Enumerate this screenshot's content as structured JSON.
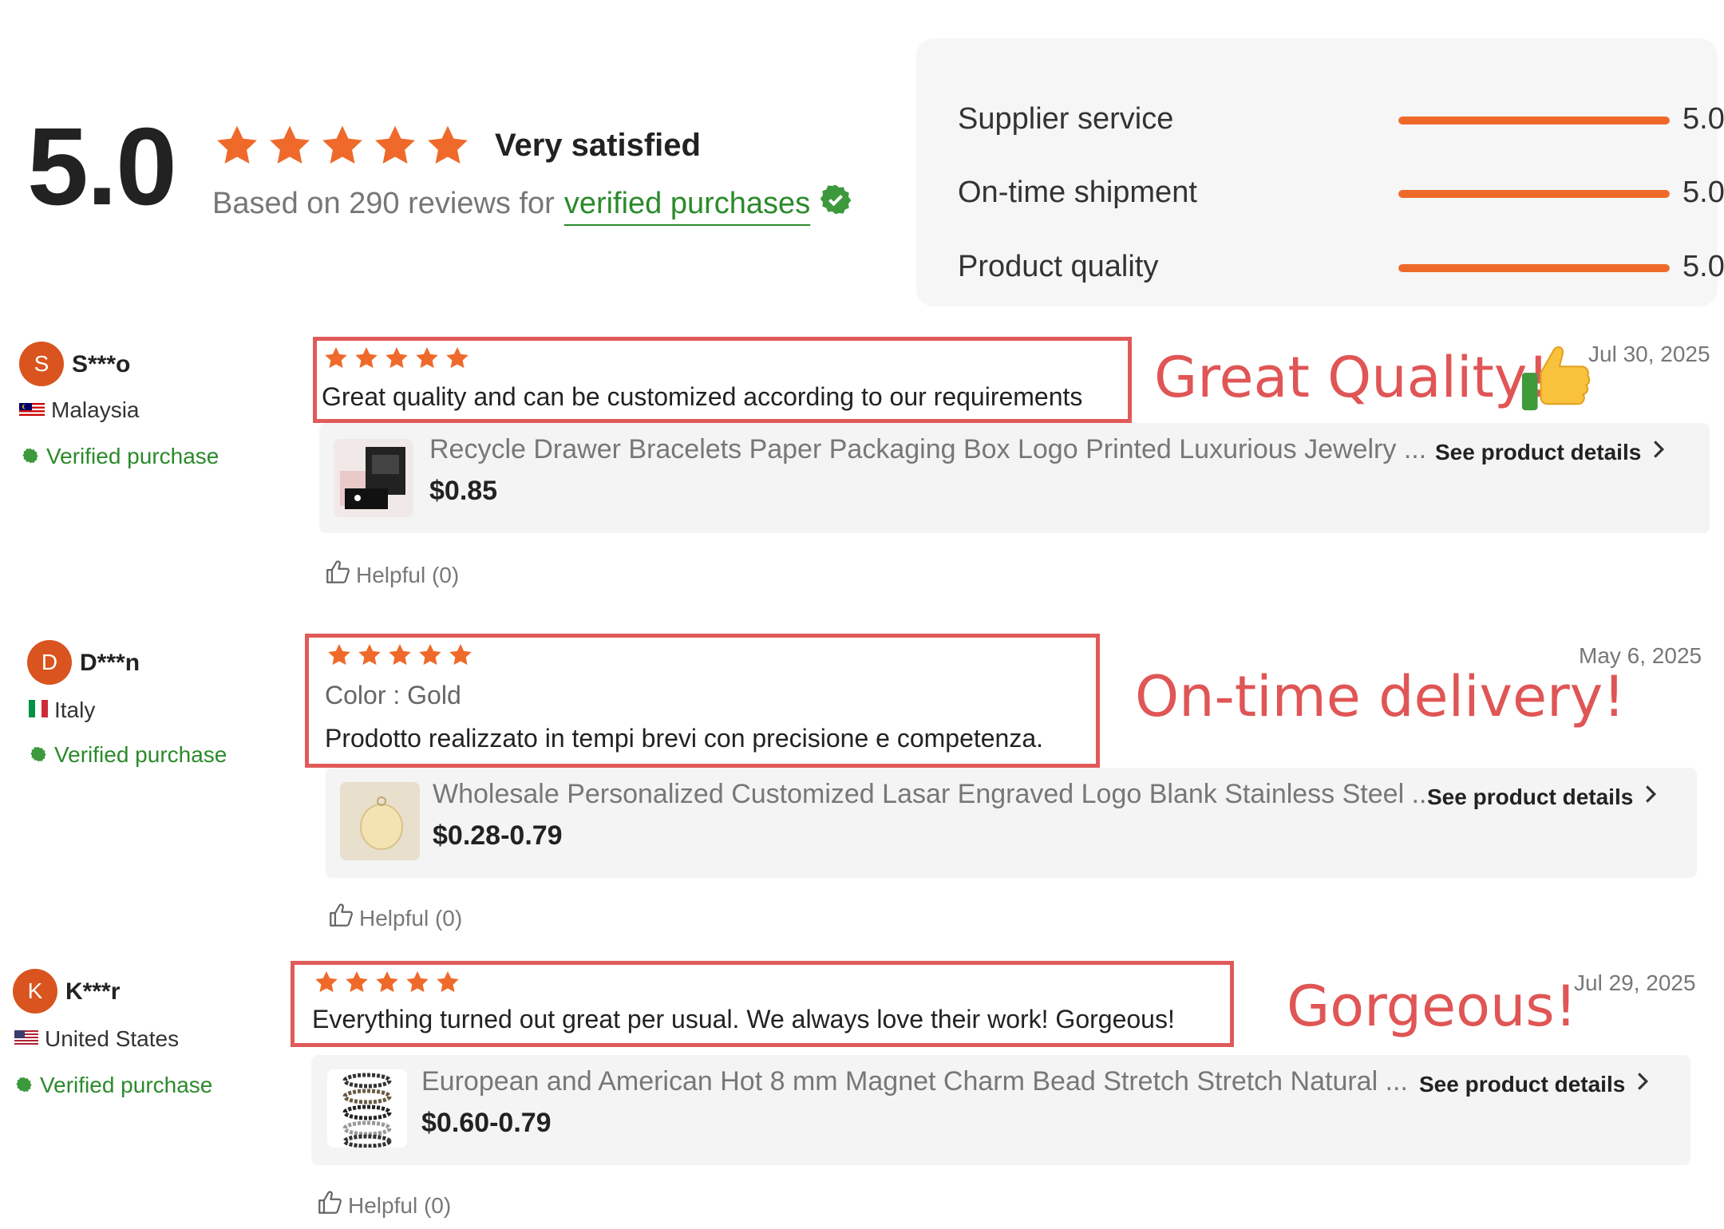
{
  "summary": {
    "score": "5.0",
    "label": "Very satisfied",
    "reviews_prefix": "Based on 290 reviews for",
    "verified_link": "verified purchases",
    "star_count": 5
  },
  "ratings": [
    {
      "label": "Supplier service",
      "value": "5.0",
      "fraction": 1.0
    },
    {
      "label": "On-time shipment",
      "value": "5.0",
      "fraction": 1.0
    },
    {
      "label": "Product quality",
      "value": "5.0",
      "fraction": 1.0
    }
  ],
  "reviews": [
    {
      "avatar_letter": "S",
      "name": "S***o",
      "country": "Malaysia",
      "verified": "Verified purchase",
      "stars": 5,
      "text": "Great quality and can be customized according to our requirements",
      "annotation": "Great Quality!",
      "date": "Jul 30, 2025",
      "product": {
        "title": "Recycle Drawer Bracelets Paper Packaging Box Logo Printed Luxurious Jewelry ...",
        "price": "$0.85",
        "details": "See product details"
      },
      "helpful": "Helpful (0)"
    },
    {
      "avatar_letter": "D",
      "name": "D***n",
      "country": "Italy",
      "verified": "Verified purchase",
      "stars": 5,
      "color_label": "Color : Gold",
      "text": "Prodotto realizzato in tempi brevi con precisione e competenza.",
      "annotation": "On-time delivery!",
      "date": "May 6, 2025",
      "product": {
        "title": "Wholesale Personalized Customized Lasar Engraved Logo Blank Stainless Steel ...",
        "price": "$0.28-0.79",
        "details": "See product details"
      },
      "helpful": "Helpful (0)"
    },
    {
      "avatar_letter": "K",
      "name": "K***r",
      "country": "United States",
      "verified": "Verified purchase",
      "stars": 5,
      "text": "Everything turned out great per usual. We always love their work! Gorgeous!",
      "annotation": "Gorgeous!",
      "date": "Jul 29, 2025",
      "product": {
        "title": "European and American Hot 8 mm Magnet Charm Bead Stretch Stretch Natural ...",
        "price": "$0.60-0.79",
        "details": "See product details"
      },
      "helpful": "Helpful (0)"
    }
  ],
  "icons": {
    "star": "star-icon",
    "verified": "verified-check-icon",
    "thumbs_up": "thumbs-up-icon",
    "chevron": "chevron-right-icon"
  },
  "colors": {
    "accent_orange": "#ef6a2a",
    "verified_green": "#2b8a2b",
    "annotation_red": "#e05555",
    "avatar": "#d9541e"
  }
}
